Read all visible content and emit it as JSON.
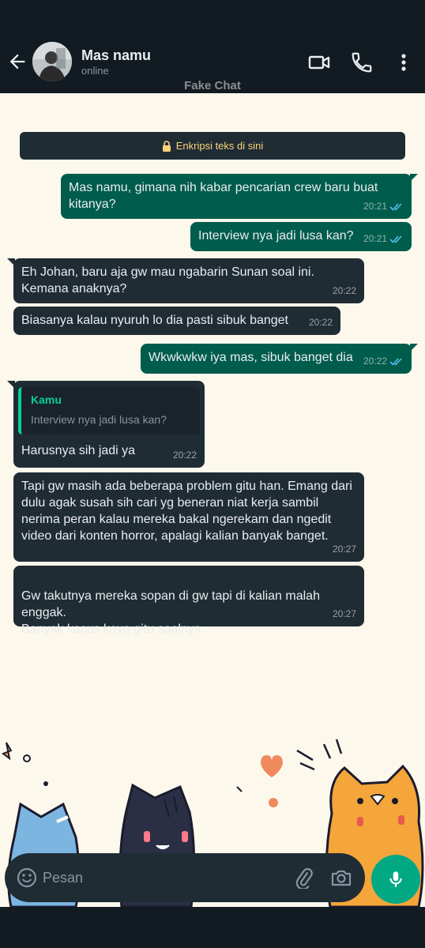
{
  "header": {
    "contact_name": "Mas namu",
    "status": "online",
    "subtitle": "Fake Chat",
    "icons": [
      "back-arrow-icon",
      "video-call-icon",
      "phone-icon",
      "more-vertical-icon"
    ]
  },
  "encryption_notice": "Enkripsi teks di sini",
  "messages": [
    {
      "direction": "out",
      "text": "Mas namu, gimana nih kabar pencarian crew baru buat kitanya?",
      "time": "20:21",
      "status": "read"
    },
    {
      "direction": "out",
      "text": "Interview nya jadi lusa kan?",
      "time": "20:21",
      "status": "read"
    },
    {
      "direction": "in",
      "text": "Eh Johan, baru aja gw mau ngabarin Sunan soal ini. Kemana anaknya?",
      "time": "20:22"
    },
    {
      "direction": "in",
      "text": "Biasanya kalau nyuruh lo dia pasti sibuk banget",
      "time": "20:22"
    },
    {
      "direction": "out",
      "text": "Wkwkwkw iya mas, sibuk banget dia",
      "time": "20:22",
      "status": "read"
    },
    {
      "direction": "in",
      "reply_to": {
        "author": "Kamu",
        "text": "Interview nya jadi lusa kan?"
      },
      "text": "Harusnya sih jadi ya",
      "time": "20:22"
    },
    {
      "direction": "in",
      "text": "Tapi gw masih ada beberapa problem gitu han. Emang dari dulu agak susah sih cari yg beneran niat kerja sambil nerima peran kalau mereka bakal ngerekam dan ngedit video dari konten horror, apalagi kalian banyak banget.",
      "time": "20:27"
    },
    {
      "direction": "in",
      "text": "Gw takutnya mereka sopan di gw tapi di kalian malah enggak.\nBanyak kasus kaya gitu soalnya",
      "time": "20:27"
    }
  ],
  "composer": {
    "placeholder": "Pesan",
    "icons": [
      "emoji-icon",
      "attach-icon",
      "camera-icon",
      "mic-icon"
    ]
  },
  "colors": {
    "header_bg": "#121b22",
    "chat_bg": "#fdf8ec",
    "outgoing_bubble": "#005c4b",
    "incoming_bubble": "#1f2c34",
    "read_ticks": "#53bdeb",
    "accent": "#00a884",
    "encryption_text": "#ffd279"
  }
}
